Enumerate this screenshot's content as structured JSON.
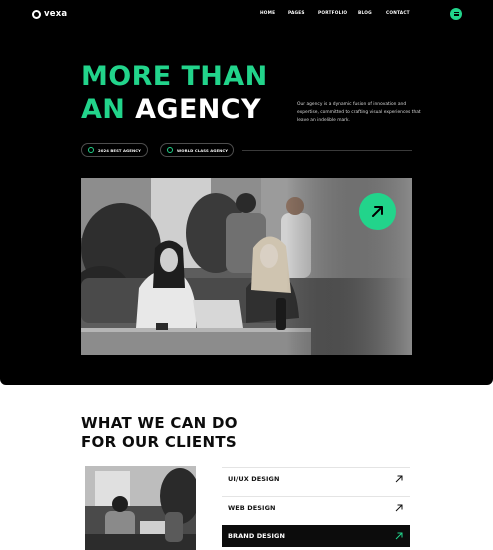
{
  "brand": {
    "name": "vexa",
    "accent": "#22d48b"
  },
  "nav": {
    "items": [
      "HOME",
      "PAGES",
      "PORTFOLIO",
      "BLOG",
      "CONTACT"
    ],
    "menu_icon": "hamburger-icon"
  },
  "hero": {
    "headline_line1": "MORE THAN",
    "headline_line2_green": "AN",
    "headline_line2_white": "AGENCY",
    "intro": "Our agency is a dynamic fusion of innovation and expertise, committed to crafting visual experiences that leave an indelible mark.",
    "badges": [
      {
        "label": "2024 BEST AGENCY",
        "icon": "award-icon"
      },
      {
        "label": "WORLD CLASS AGENCY",
        "icon": "globe-icon"
      }
    ],
    "cta_icon": "arrow-up-right-icon"
  },
  "services": {
    "title_line1": "WHAT WE CAN DO",
    "title_line2": "FOR OUR CLIENTS",
    "items": [
      {
        "label": "UI/UX DESIGN",
        "active": false
      },
      {
        "label": "WEB DESIGN",
        "active": false
      },
      {
        "label": "BRAND DESIGN",
        "active": true
      }
    ]
  }
}
